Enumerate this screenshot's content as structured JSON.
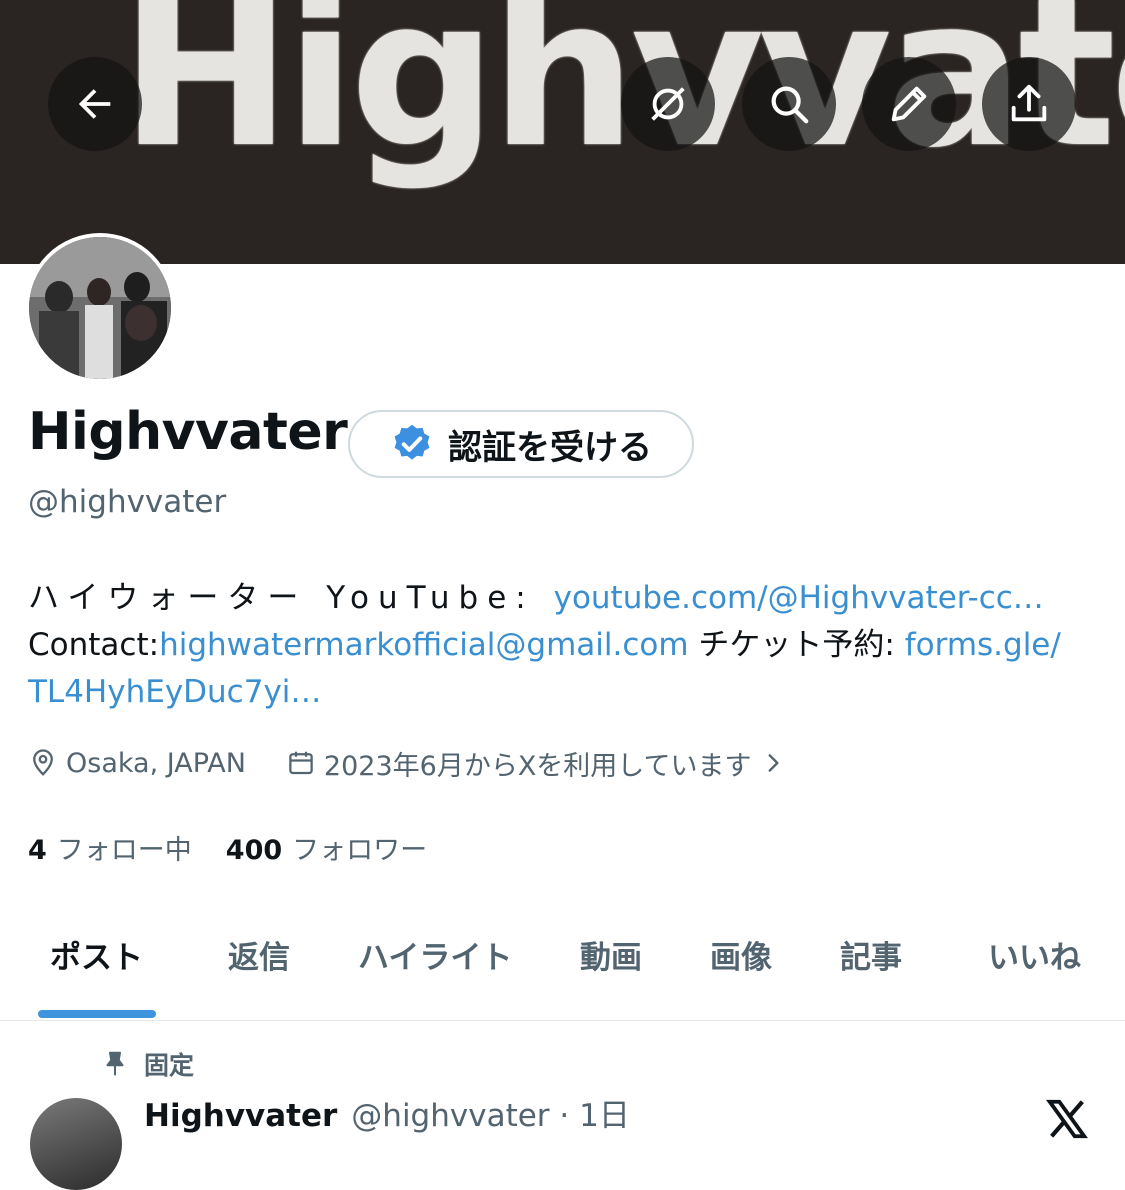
{
  "banner": {
    "text": "Highvvater"
  },
  "nav": {
    "back": "arrow-left-icon",
    "grok": "grok-icon",
    "search": "search-icon",
    "edit": "pencil-icon",
    "share": "share-icon"
  },
  "profile": {
    "display_name": "Highvvater",
    "verify_label": "認証を受ける",
    "handle": "@highvvater",
    "bio": {
      "line1_text": "ハイウォーター YouTube: ",
      "youtube_link": "youtube.com/@Highvvater-cc…",
      "contact_label": "Contact:",
      "email_link": "highwatermarkofficial@gmail.com",
      "ticket_label": " チケット予約: ",
      "forms_link_part1": "forms.gle/",
      "forms_link_part2": "TL4HyhEyDuc7yi…"
    },
    "location": "Osaka, JAPAN",
    "joined": "2023年6月からXを利用しています",
    "following_count": "4",
    "following_label": "フォロー中",
    "followers_count": "400",
    "followers_label": "フォロワー"
  },
  "tabs": [
    "ポスト",
    "返信",
    "ハイライト",
    "動画",
    "画像",
    "記事",
    "いいね"
  ],
  "post": {
    "pinned_label": "固定",
    "name": "Highvvater",
    "handle_time": "@highvvater · 1日"
  },
  "colors": {
    "accent": "#1d9bf0",
    "link": "#3a8fd0",
    "banner": "#2a2522"
  }
}
